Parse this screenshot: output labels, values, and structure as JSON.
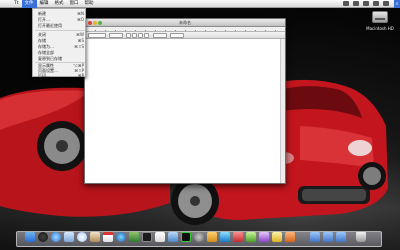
{
  "menubar": {
    "apple": "",
    "items": [
      "Tt",
      "文件",
      "编辑",
      "格式",
      "窗口",
      "帮助"
    ],
    "active_index": 1
  },
  "file_menu": {
    "items": [
      {
        "label": "新建",
        "shortcut": "⌘N"
      },
      {
        "label": "打开…",
        "shortcut": "⌘O"
      },
      {
        "label": "打开最近使用",
        "shortcut": ""
      },
      {
        "label": "关闭",
        "shortcut": "⌘W"
      },
      {
        "label": "存储",
        "shortcut": "⌘S"
      },
      {
        "label": "存储为…",
        "shortcut": "⌘⇧S"
      },
      {
        "label": "存储全部",
        "shortcut": ""
      },
      {
        "label": "复原到已存储",
        "shortcut": ""
      },
      {
        "label": "显示属性",
        "shortcut": "⌥⌘P"
      },
      {
        "label": "页面设置…",
        "shortcut": "⌘⇧P"
      },
      {
        "label": "打印…",
        "shortcut": "⌘P"
      }
    ]
  },
  "editor_window": {
    "title": "未命名"
  },
  "desktop": {
    "hdd_label": "Macintosh HD"
  },
  "dock": {
    "icons": [
      "finder-icon",
      "dashboard-icon",
      "safari-icon",
      "mail-icon",
      "ichat-icon",
      "address-book-icon",
      "ical-icon",
      "itunes-icon",
      "iphoto-icon",
      "terminal-icon",
      "textedit-icon",
      "preview-icon",
      "activity-monitor-icon",
      "system-preferences-icon",
      "app-icon",
      "app-icon",
      "app-icon",
      "app-icon",
      "app-icon",
      "app-icon",
      "app-icon",
      "downloads-stack-icon",
      "documents-stack-icon",
      "applications-stack-icon",
      "trash-icon"
    ]
  }
}
